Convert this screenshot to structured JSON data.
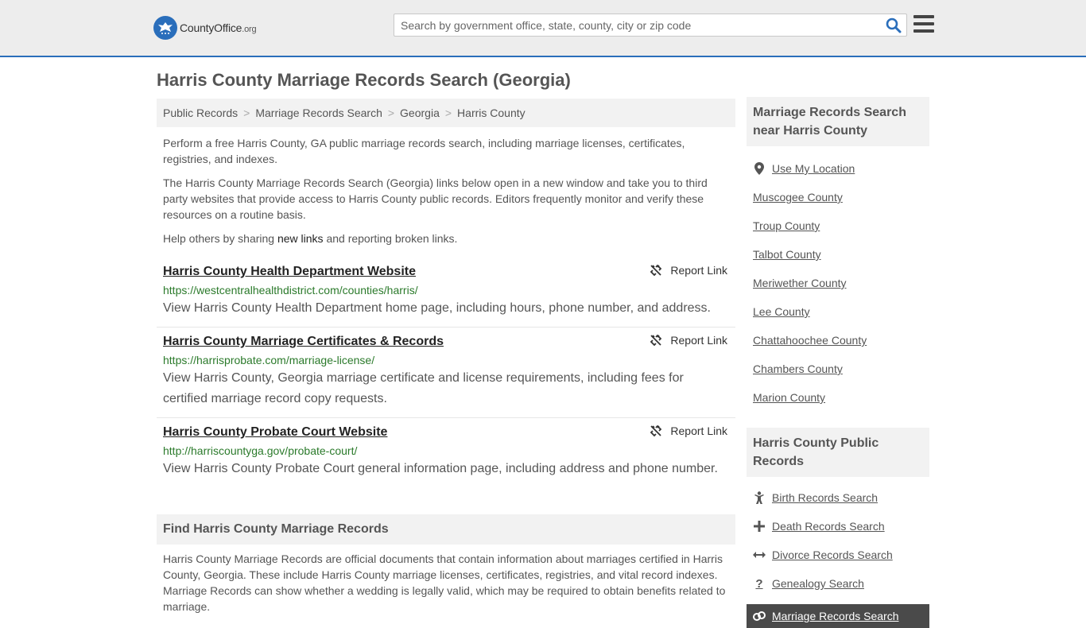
{
  "header": {
    "logo_text": "CountyOffice",
    "logo_tld": ".org",
    "search_placeholder": "Search by government office, state, county, city or zip code",
    "search_value": ""
  },
  "page_title": "Harris County Marriage Records Search (Georgia)",
  "breadcrumb": [
    "Public Records",
    "Marriage Records Search",
    "Georgia",
    "Harris County"
  ],
  "intro": {
    "p1": "Perform a free Harris County, GA public marriage records search, including marriage licenses, certificates, registries, and indexes.",
    "p2": "The Harris County Marriage Records Search (Georgia) links below open in a new window and take you to third party websites that provide access to Harris County public records. Editors frequently monitor and verify these resources on a routine basis.",
    "p3_before": "Help others by sharing ",
    "p3_link": "new links",
    "p3_after": " and reporting broken links."
  },
  "report_label": "Report Link",
  "results": [
    {
      "title": "Harris County Health Department Website",
      "url": "https://westcentralhealthdistrict.com/counties/harris/",
      "description": "View Harris County Health Department home page, including hours, phone number, and address."
    },
    {
      "title": "Harris County Marriage Certificates & Records",
      "url": "https://harrisprobate.com/marriage-license/",
      "description": "View Harris County, Georgia marriage certificate and license requirements, including fees for certified marriage record copy requests."
    },
    {
      "title": "Harris County Probate Court Website",
      "url": "http://harriscountyga.gov/probate-court/",
      "description": "View Harris County Probate Court general information page, including address and phone number."
    }
  ],
  "find_section": {
    "heading": "Find Harris County Marriage Records",
    "body": "Harris County Marriage Records are official documents that contain information about marriages certified in Harris County, Georgia. These include Harris County marriage licenses, certificates, registries, and vital record indexes. Marriage Records can show whether a wedding is legally valid, which may be required to obtain benefits related to marriage."
  },
  "sidebar": {
    "nearby_heading": "Marriage Records Search near Harris County",
    "use_location": "Use My Location",
    "nearby": [
      "Muscogee County",
      "Troup County",
      "Talbot County",
      "Meriwether County",
      "Lee County",
      "Chattahoochee County",
      "Chambers County",
      "Marion County"
    ],
    "public_heading": "Harris County Public Records",
    "public_links": [
      {
        "label": "Birth Records Search",
        "icon": "child-icon"
      },
      {
        "label": "Death Records Search",
        "icon": "cross-icon"
      },
      {
        "label": "Divorce Records Search",
        "icon": "arrows-icon"
      },
      {
        "label": "Genealogy Search",
        "icon": "question-icon"
      },
      {
        "label": "Marriage Records Search",
        "icon": "rings-icon",
        "active": true
      }
    ]
  },
  "colors": {
    "brand_blue": "#2a6ebb",
    "url_green": "#2b7a2b",
    "active_bg": "#4a4a4a"
  }
}
